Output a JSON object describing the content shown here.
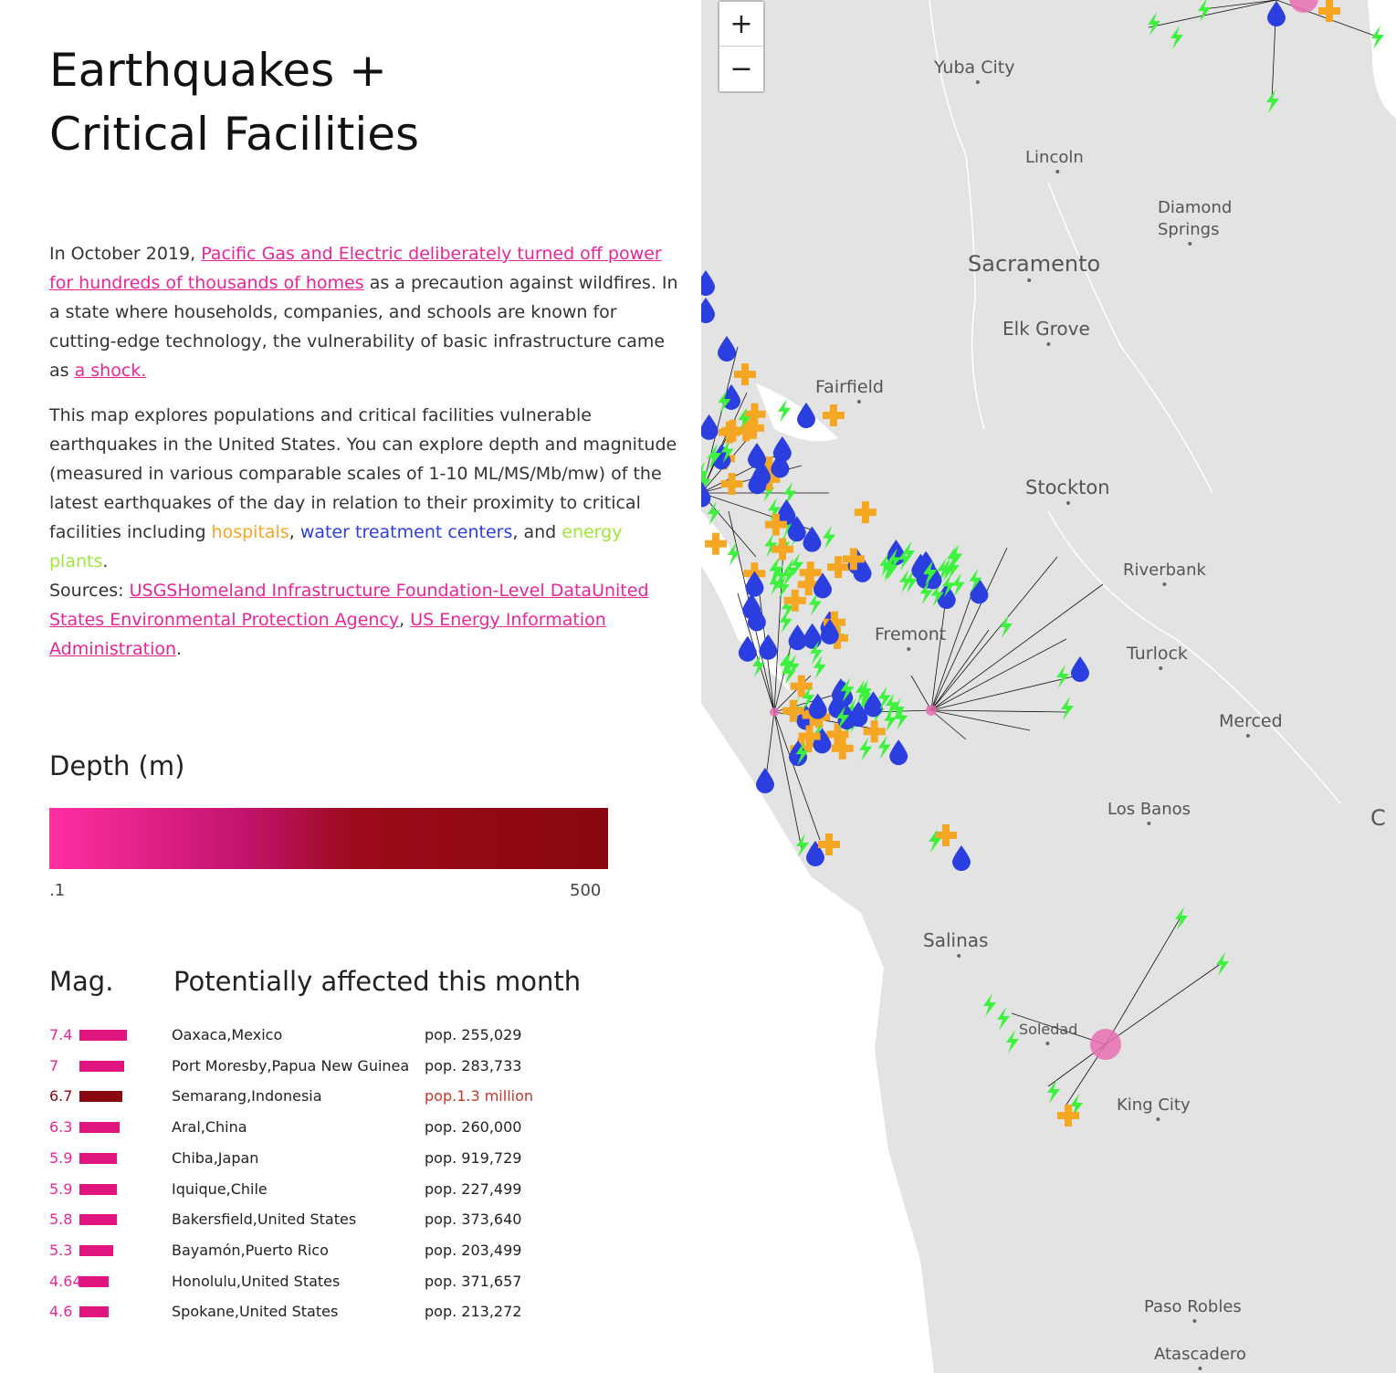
{
  "title": "Earthquakes + Critical Facilities",
  "intro": {
    "before": "In October 2019, ",
    "link1": "Pacific Gas and Electric deliberately turned off power for hundreds of thousands of homes",
    "middle": " as a precaution against wildfires. In a state where households, companies, and schools are known for cutting-edge technology, the vulnerability of basic infrastructure came as ",
    "link2": "a shock."
  },
  "description": {
    "text": "This map explores populations and critical facilities vulnerable earthquakes in the United States. You can explore depth and magnitude (measured in various comparable scales of 1-10 ML/MS/Mb/mw) of the latest earthquakes of the day in relation to their proximity to critical facilities including ",
    "hospitals": "hospitals",
    "sep1": ", ",
    "water": "water treatment centers",
    "sep2": ", and ",
    "energy": "energy plants",
    "end": "."
  },
  "sources": {
    "label": "Sources: ",
    "s1": "USGS",
    "s2": "Homeland Infrastructure Foundation-Level Data",
    "s3": "United States Environmental Protection Agency",
    "s4": "US Energy Information Administration",
    "comma": ", ",
    "end": "."
  },
  "depth_legend": {
    "title": "Depth (m)",
    "min": ".1",
    "max": "500"
  },
  "table": {
    "mag_header": "Mag.",
    "affected_header": "Potentially affected this month",
    "rows": [
      {
        "mag": "7.4",
        "place": "Oaxaca,Mexico",
        "pop": "pop. 255,029",
        "level": 0.74
      },
      {
        "mag": "7",
        "place": "Port Moresby,Papua New Guinea",
        "pop": "pop. 283,733",
        "level": 0.7
      },
      {
        "mag": "6.7",
        "place": "Semarang,Indonesia",
        "pop": "pop.1.3 million",
        "level": 0.67
      },
      {
        "mag": "6.3",
        "place": "Aral,China",
        "pop": "pop. 260,000",
        "level": 0.63
      },
      {
        "mag": "5.9",
        "place": "Chiba,Japan",
        "pop": "pop. 919,729",
        "level": 0.59
      },
      {
        "mag": "5.9",
        "place": "Iquique,Chile",
        "pop": "pop. 227,499",
        "level": 0.59
      },
      {
        "mag": "5.8",
        "place": "Bakersfield,United States",
        "pop": "pop. 373,640",
        "level": 0.58
      },
      {
        "mag": "5.3",
        "place": "Bayamón,Puerto Rico",
        "pop": "pop. 203,499",
        "level": 0.53
      },
      {
        "mag": "4.64",
        "place": "Honolulu,United States",
        "pop": "pop. 371,657",
        "level": 0.464
      },
      {
        "mag": "4.6",
        "place": "Spokane,United States",
        "pop": "pop. 213,272",
        "level": 0.46
      }
    ]
  },
  "zoom": {
    "in": "+",
    "out": "−"
  },
  "cities": [
    "Yuba City",
    "Lincoln",
    "Diamond",
    "Springs",
    "Sacramento",
    "Elk Grove",
    "Fairfield",
    "Stockton",
    "Riverbank",
    "Turlock",
    "Merced",
    "Los Banos",
    "Salinas",
    "King City",
    "Paso Robles",
    "Atascadero",
    "Fremont",
    "Soledad",
    "C"
  ],
  "colors": {
    "accent": "#e8259b",
    "hospital": "#f5a623",
    "water": "#2b3fe0",
    "energy": "#3df23d",
    "map_land": "#e3e3e3"
  }
}
